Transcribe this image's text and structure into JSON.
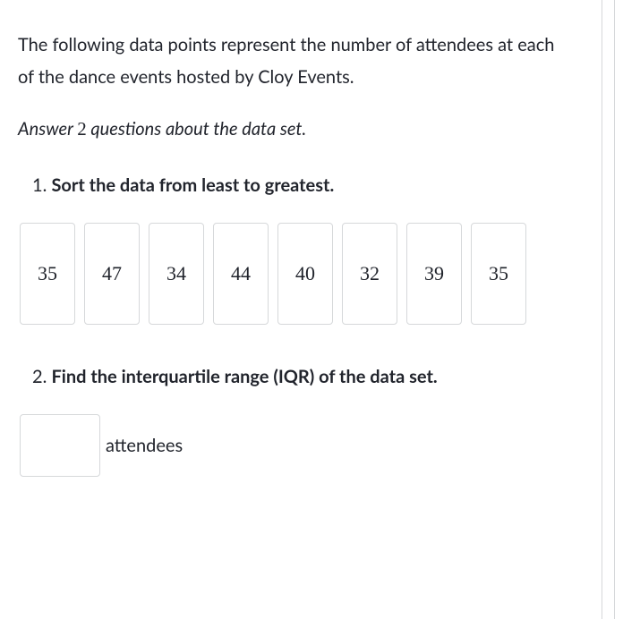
{
  "intro": "The following data points represent the number of attendees at each of the dance events hosted by Cloy Events.",
  "instruction": {
    "prefix": "Answer ",
    "count": "2",
    "suffix": " questions about the data set."
  },
  "q1": {
    "number": "1. ",
    "text": "Sort the data from least to greatest."
  },
  "data_points": [
    "35",
    "47",
    "34",
    "44",
    "40",
    "32",
    "39",
    "35"
  ],
  "q2": {
    "number": "2. ",
    "text": "Find the interquartile range (IQR) of the data set."
  },
  "answer": {
    "value": "",
    "unit": "attendees"
  }
}
